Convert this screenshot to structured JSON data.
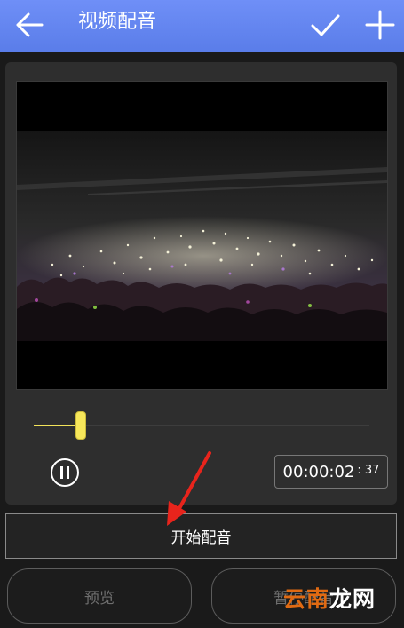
{
  "header": {
    "title": "视频配音",
    "back_icon": "back-arrow-icon",
    "confirm_icon": "check-icon",
    "add_icon": "plus-icon"
  },
  "player": {
    "progress": 0.14,
    "time": {
      "main": "00:00:02",
      "fraction": "37"
    },
    "pause_icon": "pause-icon"
  },
  "actions": {
    "start_dubbing": "开始配音",
    "preview": "预览",
    "pause_dubbing": "暂停配音"
  },
  "watermark": {
    "part1": "云南",
    "part2": "龙网"
  },
  "colors": {
    "header": "#5a7de9",
    "slider": "#f2e35a",
    "annotation_arrow": "#e8241c"
  }
}
